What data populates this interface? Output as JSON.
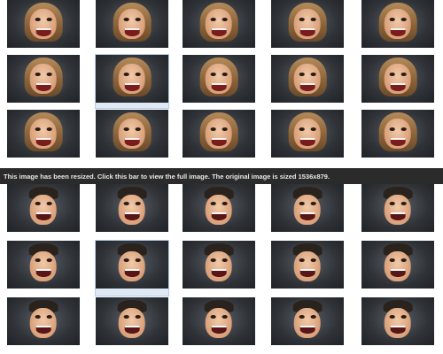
{
  "resize_notice": "This image has been resized. Click this bar to view the full image. The original image is sized 1536x879.",
  "top_grid": {
    "rows": [
      [
        "female-face",
        "female-face",
        "female-face",
        "female-face",
        "female-face"
      ],
      [
        "female-face",
        "female-face",
        "female-face",
        "female-face",
        "female-face"
      ],
      [
        "female-face",
        "female-face",
        "female-face",
        "female-face",
        "female-face"
      ]
    ],
    "selected_index": 6
  },
  "bottom_grid": {
    "rows": [
      [
        "male-face",
        "male-face",
        "male-face",
        "male-face",
        "male-face"
      ],
      [
        "male-face",
        "male-face",
        "male-face",
        "male-face",
        "male-face"
      ],
      [
        "male-face",
        "male-face",
        "male-face",
        "male-face",
        "male-face"
      ]
    ],
    "selected_index": 6
  },
  "colors": {
    "page_background": "#ffffff",
    "resize_bar": "#2b2b2b",
    "resize_bar_text": "#e8e8e8",
    "selected_tile": "#dfe9f6"
  }
}
